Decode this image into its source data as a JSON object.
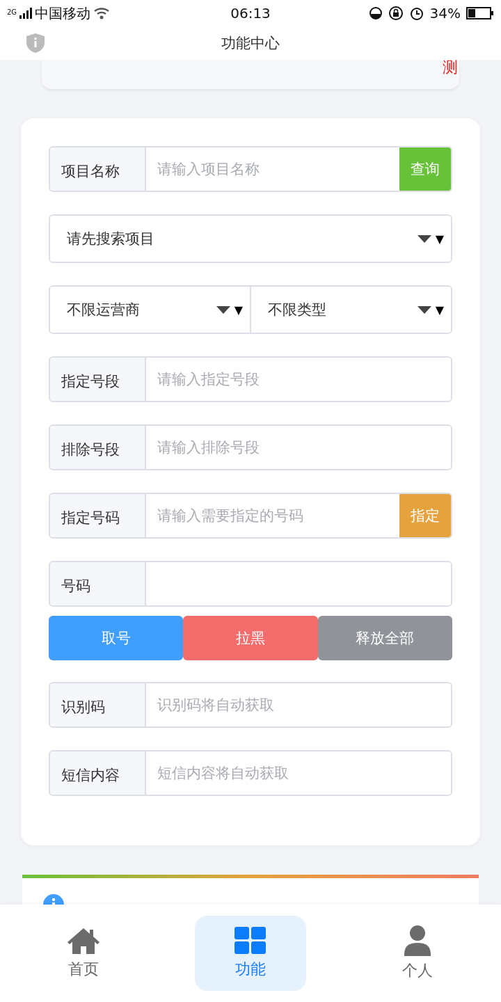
{
  "status_bar": {
    "network": "2G",
    "carrier": "中国移动",
    "time": "06:13",
    "battery": "34%"
  },
  "header": {
    "title": "功能中心"
  },
  "top_card": {
    "text": "测"
  },
  "form": [
    {
      "kind": "input",
      "label": "项目名称",
      "placeholder": "请输入项目名称",
      "button": {
        "label": "查询",
        "color": "#67c23a"
      }
    },
    {
      "kind": "select",
      "options": [
        {
          "value": "请先搜索项目",
          "arrow": "▼"
        }
      ]
    },
    {
      "kind": "select",
      "options": [
        {
          "value": "不限运营商",
          "arrow": "▼"
        },
        {
          "value": "不限类型",
          "arrow": "▼"
        }
      ]
    },
    {
      "kind": "input",
      "label": "指定号段",
      "placeholder": "请输入指定号段"
    },
    {
      "kind": "input",
      "label": "排除号段",
      "placeholder": "请输入排除号段"
    },
    {
      "kind": "input",
      "label": "指定号码",
      "placeholder": "请输入需要指定的号码",
      "button": {
        "label": "指定",
        "color": "#e6a23c"
      }
    },
    {
      "kind": "input",
      "label": "号码"
    },
    {
      "kind": "buttons",
      "buttons": [
        {
          "label": "取号",
          "color": "#409eff"
        },
        {
          "label": "拉黑",
          "color": "#f56c6c"
        },
        {
          "label": "释放全部",
          "color": "#909399"
        }
      ]
    },
    {
      "kind": "input",
      "label": "识别码",
      "placeholder": "识别码将自动获取"
    },
    {
      "kind": "input",
      "label": "短信内容",
      "placeholder": "短信内容将自动获取"
    }
  ],
  "tabs": [
    {
      "label": "首页",
      "selected": false
    },
    {
      "label": "功能",
      "selected": true
    },
    {
      "label": "个人",
      "selected": false
    }
  ]
}
